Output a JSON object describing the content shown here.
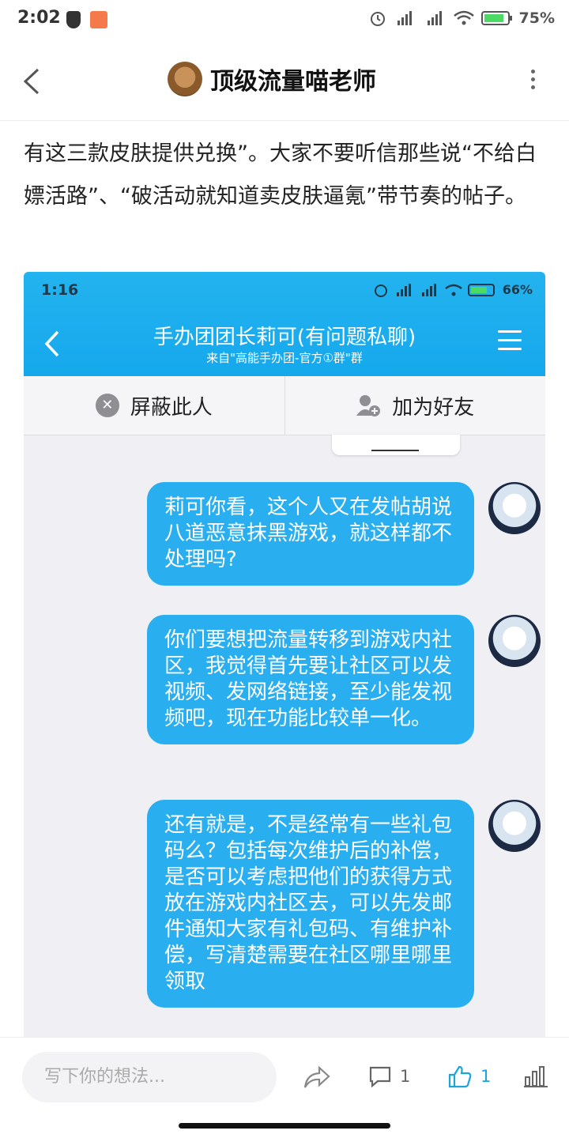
{
  "status_bar": {
    "time": "2:02",
    "battery": "75%"
  },
  "header": {
    "title": "顶级流量喵老师"
  },
  "article": {
    "text": "有这三款皮肤提供兑换”。大家不要听信那些说“不给白嫖活路”、“破活动就知道卖皮肤逼氪”带节奏的帖子。"
  },
  "screenshot": {
    "status_bar": {
      "time": "1:16",
      "battery": "66%"
    },
    "title": "手办团团长莉可(有问题私聊)",
    "subtitle": "来自\"高能手办团-官方①群\"群",
    "actions": {
      "block": "屏蔽此人",
      "add_friend": "加为好友"
    },
    "messages": [
      {
        "text": "莉可你看，这个人又在发帖胡说八道恶意抹黑游戏，就这样都不处理吗?"
      },
      {
        "text": "你们要想把流量转移到游戏内社区，我觉得首先要让社区可以发视频、发网络链接，至少能发视频吧，现在功能比较单一化。"
      },
      {
        "text": "还有就是，不是经常有一些礼包码么？包括每次维护后的补偿，是否可以考虑把他们的获得方式放在游戏内社区去，可以先发邮件通知大家有礼包码、有维护补偿，写清楚需要在社区哪里哪里领取"
      }
    ]
  },
  "bottom_bar": {
    "placeholder": "写下你的想法...",
    "comment_count": "1",
    "like_count": "1"
  },
  "colors": {
    "accent": "#29aef0",
    "like": "#1aa6d8"
  }
}
